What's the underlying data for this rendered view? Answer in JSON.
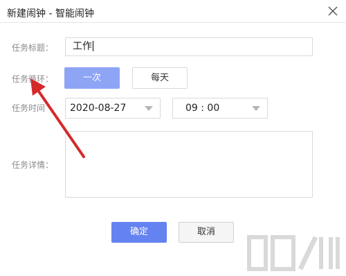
{
  "dialog": {
    "title": "新建闹钟 - 智能闹钟",
    "close_icon": "close-icon"
  },
  "form": {
    "title_label": "任务标题：",
    "title_value": "工作",
    "repeat_label": "任务循环：",
    "repeat_options": [
      "一次",
      "每天"
    ],
    "repeat_selected": "一次",
    "time_label": "任务时间",
    "date_value": "2020-08-27",
    "time_value": "09 : 00",
    "details_label": "任务详情：",
    "details_value": ""
  },
  "buttons": {
    "ok": "确定",
    "cancel": "取消"
  },
  "colors": {
    "selected_option": "#8ea4f5",
    "primary": "#6483f0",
    "annotation_arrow": "#d42a2a"
  }
}
